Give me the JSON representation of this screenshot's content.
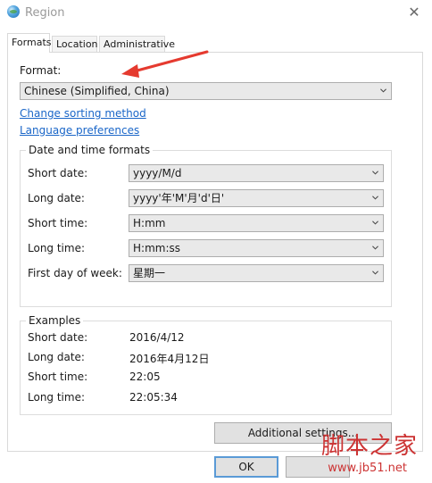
{
  "window": {
    "title": "Region"
  },
  "tabs": [
    {
      "label": "Formats",
      "active": true
    },
    {
      "label": "Location",
      "active": false
    },
    {
      "label": "Administrative",
      "active": false
    }
  ],
  "format": {
    "label": "Format:",
    "value": "Chinese (Simplified, China)"
  },
  "links": {
    "sorting": "Change sorting method",
    "language": "Language preferences"
  },
  "date_time_formats": {
    "title": "Date and time formats",
    "rows": [
      {
        "label": "Short date:",
        "value": "yyyy/M/d"
      },
      {
        "label": "Long date:",
        "value": "yyyy'年'M'月'd'日'"
      },
      {
        "label": "Short time:",
        "value": "H:mm"
      },
      {
        "label": "Long time:",
        "value": "H:mm:ss"
      },
      {
        "label": "First day of week:",
        "value": "星期一"
      }
    ]
  },
  "examples": {
    "title": "Examples",
    "rows": [
      {
        "label": "Short date:",
        "value": "2016/4/12"
      },
      {
        "label": "Long date:",
        "value": "2016年4月12日"
      },
      {
        "label": "Short time:",
        "value": "22:05"
      },
      {
        "label": "Long time:",
        "value": "22:05:34"
      }
    ]
  },
  "buttons": {
    "additional": "Additional settings...",
    "ok": "OK"
  },
  "watermark": {
    "text": "脚本之家",
    "url": "www.jb51.net"
  },
  "colors": {
    "link": "#1a66c8",
    "arrow": "#e53a2f",
    "watermark": "#cc3333"
  },
  "icons": {
    "app": "globe-icon",
    "close": "close-icon",
    "dropdown": "chevron-down-icon"
  }
}
